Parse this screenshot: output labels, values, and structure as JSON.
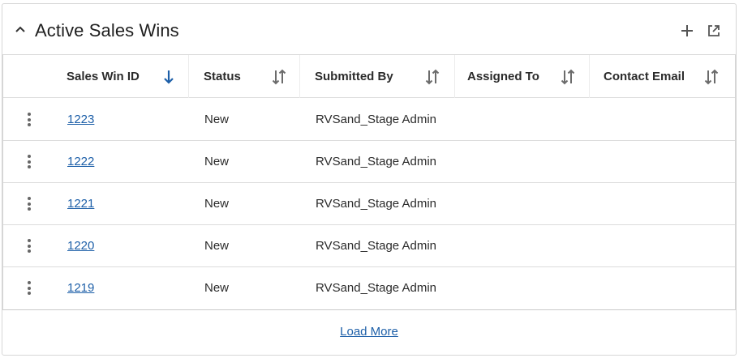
{
  "panel": {
    "title": "Active Sales Wins",
    "add_icon": "plus-icon",
    "popout_icon": "external-link-icon",
    "collapse_icon": "chevron-up-icon"
  },
  "table": {
    "columns": [
      {
        "label": "Sales Win ID",
        "sort": "descending"
      },
      {
        "label": "Status",
        "sort": "unsorted"
      },
      {
        "label": "Submitted By",
        "sort": "unsorted"
      },
      {
        "label": "Assigned To",
        "sort": "unsorted"
      },
      {
        "label": "Contact Email",
        "sort": "unsorted"
      }
    ],
    "rows": [
      {
        "id": "1223",
        "status": "New",
        "submitted_by": "RVSand_Stage Admin",
        "assigned_to": "",
        "contact_email": ""
      },
      {
        "id": "1222",
        "status": "New",
        "submitted_by": "RVSand_Stage Admin",
        "assigned_to": "",
        "contact_email": ""
      },
      {
        "id": "1221",
        "status": "New",
        "submitted_by": "RVSand_Stage Admin",
        "assigned_to": "",
        "contact_email": ""
      },
      {
        "id": "1220",
        "status": "New",
        "submitted_by": "RVSand_Stage Admin",
        "assigned_to": "",
        "contact_email": ""
      },
      {
        "id": "1219",
        "status": "New",
        "submitted_by": "RVSand_Stage Admin",
        "assigned_to": "",
        "contact_email": ""
      }
    ]
  },
  "footer": {
    "load_more_label": "Load More"
  },
  "colors": {
    "link": "#1d5fa8",
    "active_sort": "#1d5fa8",
    "inactive_sort": "#6b6b6b"
  }
}
